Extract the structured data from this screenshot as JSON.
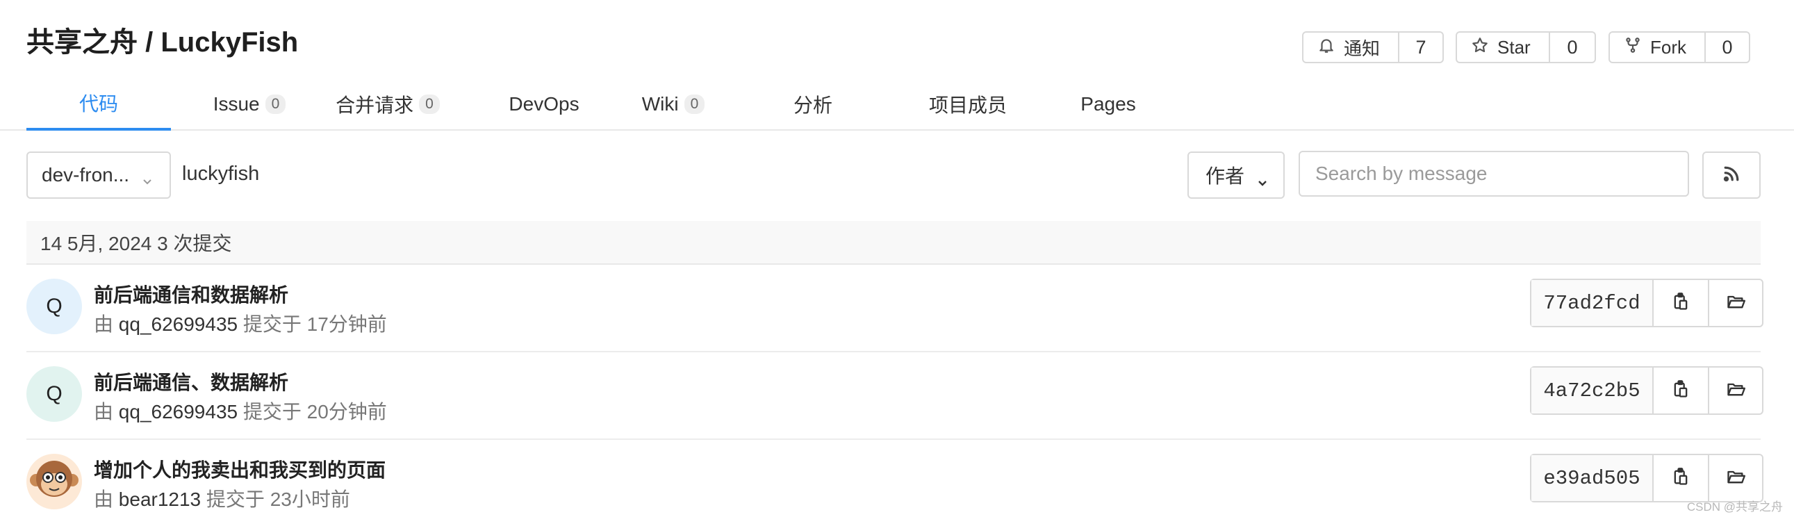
{
  "project": {
    "title": "共享之舟 / LuckyFish"
  },
  "header_buttons": {
    "notify": {
      "label": "通知",
      "count": "7"
    },
    "star": {
      "label": "Star",
      "count": "0"
    },
    "fork": {
      "label": "Fork",
      "count": "0"
    }
  },
  "tabs": [
    {
      "label": "代码",
      "active": true
    },
    {
      "label": "Issue",
      "badge": "0"
    },
    {
      "label": "合并请求",
      "badge": "0"
    },
    {
      "label": "DevOps"
    },
    {
      "label": "Wiki",
      "badge": "0"
    },
    {
      "label": "分析"
    },
    {
      "label": "项目成员"
    },
    {
      "label": "Pages"
    }
  ],
  "toolbar": {
    "branch": "dev-fron...",
    "path": "luckyfish",
    "author_filter": "作者",
    "search_placeholder": "Search by message"
  },
  "date_group": "14 5月, 2024 3 次提交",
  "commits": [
    {
      "avatar_letter": "Q",
      "avatar_bg": "#e3f1fc",
      "title": "前后端通信和数据解析",
      "by": "由",
      "author": "qq_62699435",
      "time": "提交于 17分钟前",
      "sha": "77ad2fcd"
    },
    {
      "avatar_letter": "Q",
      "avatar_bg": "#e1f3ef",
      "title": "前后端通信、数据解析",
      "by": "由",
      "author": "qq_62699435",
      "time": "提交于 20分钟前",
      "sha": "4a72c2b5"
    },
    {
      "avatar_letter": "",
      "avatar_bg": "#fde9d6",
      "avatar_icon": "monkey-avatar",
      "title": "增加个人的我卖出和我买到的页面",
      "by": "由",
      "author": "bear1213",
      "time": "提交于 23小时前",
      "sha": "e39ad505"
    }
  ],
  "watermark": "CSDN @共享之舟",
  "colors": {
    "accent": "#2d8cf0",
    "border": "#d9d9d9"
  },
  "icons": [
    "bell-icon",
    "star-icon",
    "fork-icon",
    "chevron-down-icon",
    "rss-icon",
    "copy-icon",
    "folder-icon"
  ]
}
